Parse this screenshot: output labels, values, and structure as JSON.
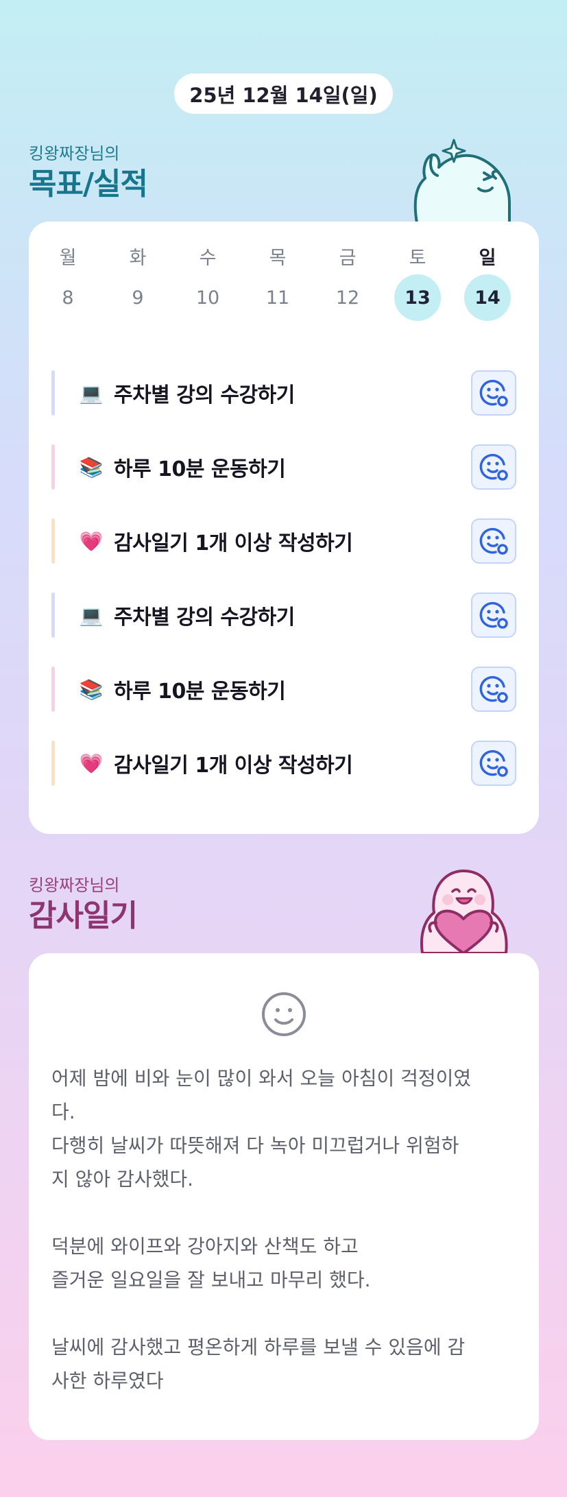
{
  "date_label": "25년 12월 14일(일)",
  "goal_section": {
    "subtitle": "킹왕짜장님의",
    "title": "목표/실적"
  },
  "week": {
    "days": [
      "월",
      "화",
      "수",
      "목",
      "금",
      "토",
      "일"
    ],
    "dates": [
      "8",
      "9",
      "10",
      "11",
      "12",
      "13",
      "14"
    ],
    "highlighted": [
      "13",
      "14"
    ]
  },
  "goals": [
    {
      "emoji": "💻",
      "label": "주차별 강의 수강하기",
      "bar_color": "#d4dcfa"
    },
    {
      "emoji": "📚",
      "label": "하루 10분 운동하기",
      "bar_color": "#fad1e4"
    },
    {
      "emoji": "💗",
      "label": "감사일기 1개 이상 작성하기",
      "bar_color": "#fde1bf"
    },
    {
      "emoji": "💻",
      "label": "주차별 강의 수강하기",
      "bar_color": "#d4dcfa"
    },
    {
      "emoji": "📚",
      "label": "하루 10분 운동하기",
      "bar_color": "#fad1e4"
    },
    {
      "emoji": "💗",
      "label": "감사일기 1개 이상 작성하기",
      "bar_color": "#fde1bf"
    }
  ],
  "diary_section": {
    "subtitle": "킹왕짜장님의",
    "title": "감사일기"
  },
  "diary": {
    "text": "어제 밤에 비와 눈이 많이 와서 오늘 아침이 걱정이였\n다.\n다행히 날씨가 따뜻해져 다 녹아 미끄럽거나 위험하\n지 않아 감사했다.\n\n덕분에 와이프와 강아지와 산책도 하고\n즐거운 일요일을 잘 보내고 마무리 했다.\n\n날씨에 감사했고 평온하게 하루를 보낼 수 있음에 감\n사한 하루였다"
  },
  "colors": {
    "accent_goal": "#17758c",
    "accent_diary": "#8e3570",
    "smile_icon": "#2f63e0"
  }
}
